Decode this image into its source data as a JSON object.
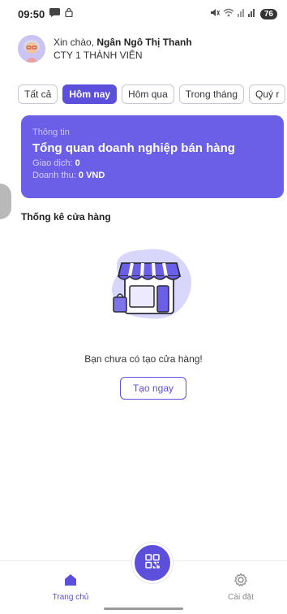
{
  "status_bar": {
    "time": "09:50",
    "battery": "76"
  },
  "header": {
    "greeting": "Xin chào, ",
    "user_name": "Ngân Ngô Thị Thanh",
    "company": "CTY 1 THÀNH VIÊN"
  },
  "tabs": [
    {
      "label": "Tất cả",
      "active": false
    },
    {
      "label": "Hôm nay",
      "active": true
    },
    {
      "label": "Hôm qua",
      "active": false
    },
    {
      "label": "Trong tháng",
      "active": false
    },
    {
      "label": "Quý r",
      "active": false
    }
  ],
  "info_card": {
    "label": "Thông tin",
    "title": "Tổng quan doanh nghiệp bán hàng",
    "transactions_label": "Giao dịch:",
    "transactions_value": "0",
    "revenue_label": "Doanh thu:",
    "revenue_value": "0 VND"
  },
  "store_section": {
    "title": "Thống kê cửa hàng",
    "empty_message": "Bạn chưa có tạo cửa hàng!",
    "create_button": "Tạo ngay"
  },
  "bottom_nav": {
    "home_label": "Trang chủ",
    "settings_label": "Cài đặt"
  },
  "colors": {
    "primary": "#5c4fdc",
    "card": "#6a5fe6"
  }
}
